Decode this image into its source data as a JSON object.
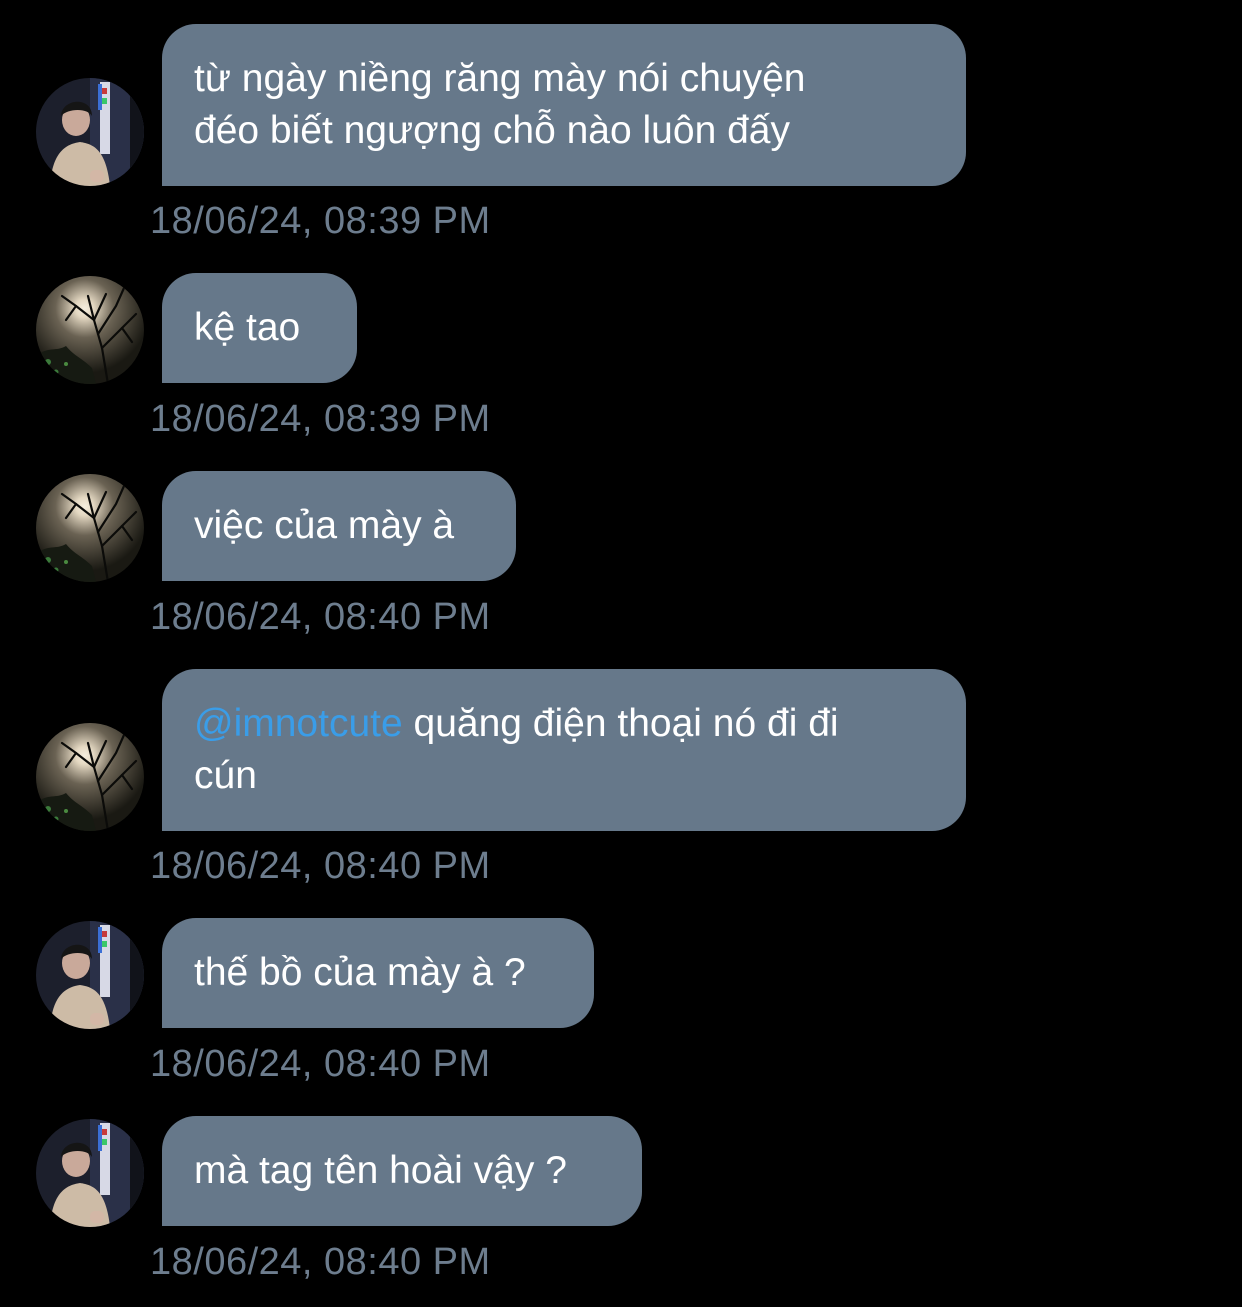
{
  "messages": [
    {
      "avatar": "boy-photo",
      "text": "từ ngày niềng răng mày nói chuyện\nđéo biết ngượng chỗ nào luôn đấy",
      "time": "18/06/24, 08:39 PM"
    },
    {
      "avatar": "moon-tree-photo",
      "text": "kệ tao",
      "time": "18/06/24, 08:39 PM"
    },
    {
      "avatar": "moon-tree-photo",
      "text": "việc của mày à",
      "time": "18/06/24, 08:40 PM"
    },
    {
      "avatar": "moon-tree-photo",
      "mention": "@imnotcute",
      "text": " quăng điện thoại nó đi đi\ncún",
      "time": "18/06/24, 08:40 PM"
    },
    {
      "avatar": "boy-photo",
      "text": "thế bồ của mày à ?",
      "time": "18/06/24, 08:40 PM"
    },
    {
      "avatar": "boy-photo",
      "text": "mà tag tên hoài vậy ?",
      "time": "18/06/24, 08:40 PM"
    }
  ],
  "colors": {
    "background": "#000000",
    "bubble": "#66788a",
    "text": "#ffffff",
    "mention": "#3a9de8",
    "timestamp": "#6d7d8e"
  }
}
